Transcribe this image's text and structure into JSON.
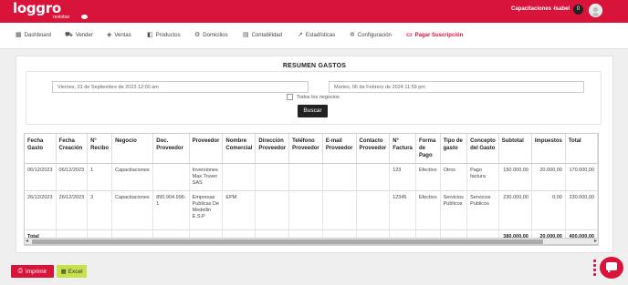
{
  "brand": {
    "logo": "loggro",
    "tagline": "restobar"
  },
  "topbar": {
    "menu_label": "Capacitaciones -",
    "user_name": "Isabel",
    "notification_count": "0"
  },
  "nav": [
    {
      "label": "Dashboard",
      "icon": "dashboard-icon"
    },
    {
      "label": "Vender",
      "icon": "cart-icon"
    },
    {
      "label": "Ventas",
      "icon": "tag-icon"
    },
    {
      "label": "Productos",
      "icon": "cube-icon"
    },
    {
      "label": "Domicilios",
      "icon": "motorbike-icon"
    },
    {
      "label": "Contabilidad",
      "icon": "ledger-icon"
    },
    {
      "label": "Estadísticas",
      "icon": "chart-line-icon"
    },
    {
      "label": "Configuración",
      "icon": "gear-icon"
    },
    {
      "label": "Pagar Suscripción",
      "icon": "card-icon"
    }
  ],
  "report": {
    "title": "RESUMEN GASTOS",
    "date_from": "Viernes, 01 de Septiembre de 2023 12:00 am",
    "date_to": "Martes, 06 de Febrero de 2024 11:59 pm",
    "all_businesses_label": "Todos los negocios",
    "search_button": "Buscar"
  },
  "table": {
    "headers": [
      "Fecha Gasto",
      "Fecha Creación",
      "N° Recibo",
      "Negocio",
      "Doc. Proveedor",
      "Proveedor",
      "Nombre Comercial",
      "Dirección Proveedor",
      "Teléfono Proveedor",
      "E-mail Proveedor",
      "Contacto Proveedor",
      "N° Factura",
      "Forma de Pago",
      "Tipo de gasto",
      "Concepto del Gasto",
      "Subtotal",
      "Impuestos",
      "Total"
    ],
    "rows": [
      [
        "06/12/2023",
        "06/12/2023",
        "1",
        "Capacitaciones",
        "",
        "Inversiones Max Truver SAS",
        "",
        "",
        "",
        "",
        "",
        "123",
        "Efectivo",
        "Otros",
        "Pago factura",
        "150.000,00",
        "20.000,00",
        "170.000,00"
      ],
      [
        "26/12/2023",
        "26/12/2023",
        "3",
        "Capacitaciones",
        "890.904.996-1",
        "Empresas Publicas De Medellin E.S.P",
        "EPM",
        "",
        "",
        "",
        "",
        "12345",
        "Efectivo",
        "Servicios Publicos",
        "Servicios Publicos",
        "230.000,00",
        "0,00",
        "230.000,00"
      ]
    ],
    "total_label": "Total",
    "total_subtotal": "380.000,00",
    "total_tax": "20.000,00",
    "total_total": "400.000,00"
  },
  "actions": {
    "print_label": "Imprimir",
    "excel_label": "Excel"
  },
  "colors": {
    "brand": "#d8143a",
    "excel": "#c7e14a",
    "dark_button": "#222222"
  }
}
